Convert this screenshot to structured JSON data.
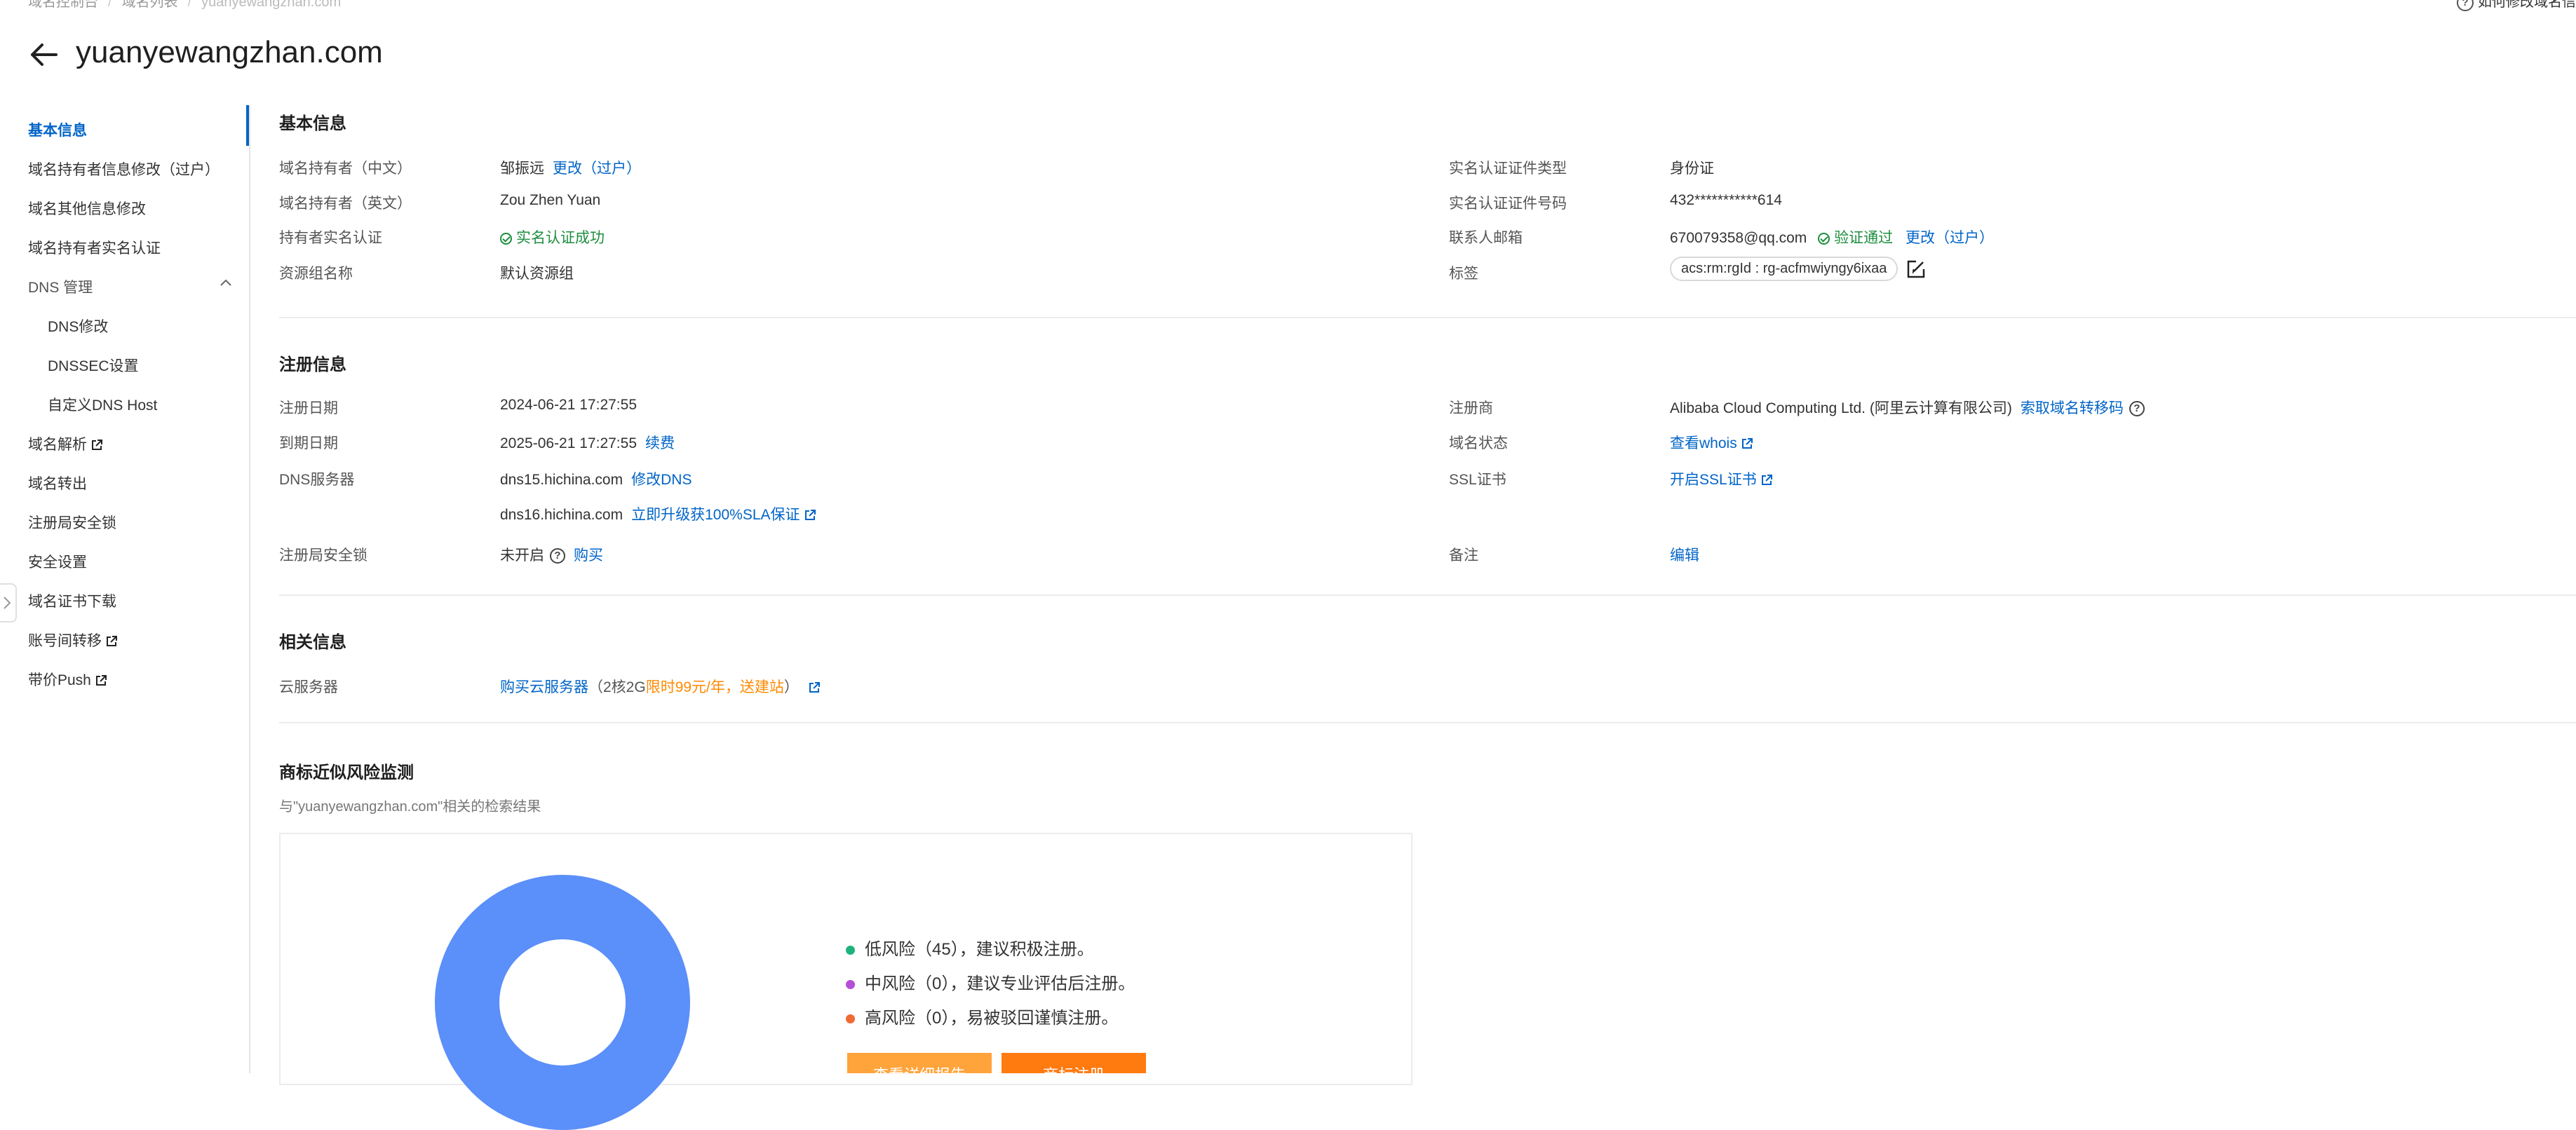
{
  "breadcrumb": [
    "域名控制台",
    "域名列表",
    "yuanyewangzhan.com"
  ],
  "help_link": "如何修改域名信",
  "page_title": "yuanyewangzhan.com",
  "sidebar": {
    "items": [
      {
        "label": "基本信息",
        "active": true
      },
      {
        "label": "域名持有者信息修改（过户）"
      },
      {
        "label": "域名其他信息修改"
      },
      {
        "label": "域名持有者实名认证"
      },
      {
        "label": "DNS 管理"
      },
      {
        "label": "DNS修改"
      },
      {
        "label": "DNSSEC设置"
      },
      {
        "label": "自定义DNS Host"
      },
      {
        "label": "域名解析"
      },
      {
        "label": "域名转出"
      },
      {
        "label": "注册局安全锁"
      },
      {
        "label": "安全设置"
      },
      {
        "label": "域名证书下载"
      },
      {
        "label": "账号间转移"
      },
      {
        "label": "带价Push"
      }
    ]
  },
  "basic": {
    "title": "基本信息",
    "owner_cn_label": "域名持有者（中文）",
    "owner_cn_value": "邹振远",
    "owner_cn_link": "更改（过户）",
    "owner_en_label": "域名持有者（英文）",
    "owner_en_value": "Zou Zhen Yuan",
    "realname_label": "持有者实名认证",
    "realname_value": "实名认证成功",
    "resource_group_label": "资源组名称",
    "resource_group_value": "默认资源组",
    "cert_type_label": "实名认证证件类型",
    "cert_type_value": "身份证",
    "cert_no_label": "实名认证证件号码",
    "cert_no_value": "432***********614",
    "email_label": "联系人邮箱",
    "email_value": "670079358@qq.com",
    "email_status": "验证通过",
    "email_link": "更改（过户）",
    "tag_label": "标签",
    "tag_value": "acs:rm:rgId : rg-acfmwiyngy6ixaa"
  },
  "registration": {
    "title": "注册信息",
    "reg_date_label": "注册日期",
    "reg_date_value": "2024-06-21 17:27:55",
    "exp_date_label": "到期日期",
    "exp_date_value": "2025-06-21 17:27:55",
    "renew_link": "续费",
    "dns_label": "DNS服务器",
    "dns1": "dns15.hichina.com",
    "dns_modify_link": "修改DNS",
    "dns2": "dns16.hichina.com",
    "sla_link": "立即升级获100%SLA保证",
    "lock_label": "注册局安全锁",
    "lock_value": "未开启",
    "buy_link": "购买",
    "registrar_label": "注册商",
    "registrar_value": "Alibaba Cloud Computing Ltd. (阿里云计算有限公司)",
    "transfer_code_link": "索取域名转移码",
    "status_label": "域名状态",
    "whois_link": "查看whois",
    "ssl_label": "SSL证书",
    "ssl_link": "开启SSL证书",
    "remark_label": "备注",
    "remark_link": "编辑"
  },
  "related": {
    "title": "相关信息",
    "cloud_label": "云服务器",
    "cloud_link": "购买云服务器",
    "cloud_note_open": "（2核2G",
    "cloud_note_promo": "限时99元/年，送建站",
    "cloud_note_close": "）"
  },
  "trademark": {
    "title": "商标近似风险监测",
    "subtitle": "与\"yuanyewangzhan.com\"相关的检索结果",
    "legend": [
      {
        "text": "低风险（45），建议积极注册。",
        "color": "#1db37a"
      },
      {
        "text": "中风险（0），建议专业评估后注册。",
        "color": "#b44fd8"
      },
      {
        "text": "高风险（0），易被驳回谨慎注册。",
        "color": "#f06a35"
      }
    ],
    "button_details": "查看详细报告",
    "button_register": "商标注册",
    "donut_color": "#5b8ff9"
  },
  "colors": {
    "accent": "#0064c8",
    "success": "#1e8e3e",
    "promo": "#ff8a00"
  }
}
